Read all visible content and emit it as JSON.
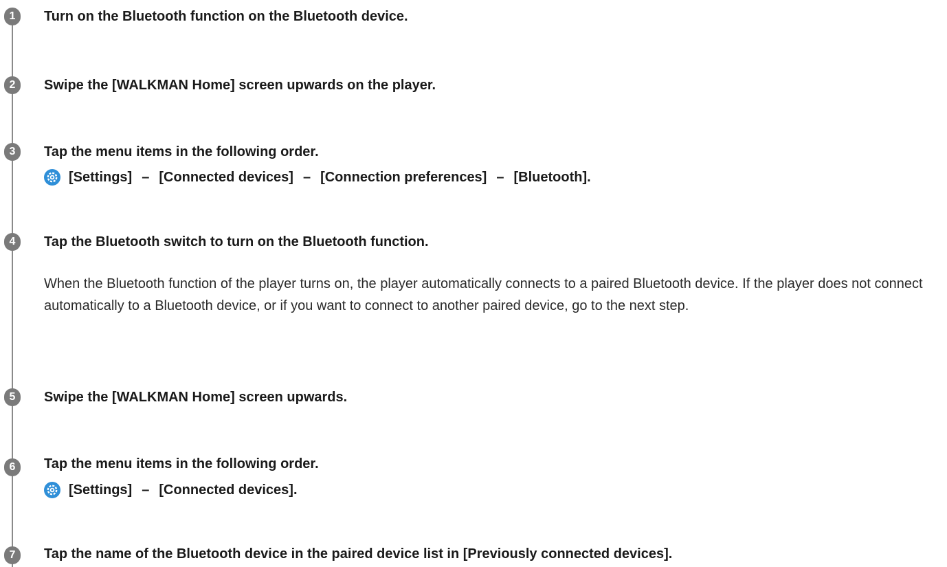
{
  "steps": [
    {
      "number": "1",
      "title": "Turn on the Bluetooth function on the Bluetooth device."
    },
    {
      "number": "2",
      "title": "Swipe the [WALKMAN Home] screen upwards on the player."
    },
    {
      "number": "3",
      "title": "Tap the menu items in the following order.",
      "path": [
        "[Settings]",
        "[Connected devices]",
        "[Connection preferences]",
        "[Bluetooth]."
      ],
      "separator": "–"
    },
    {
      "number": "4",
      "title": "Tap the Bluetooth switch to turn on the Bluetooth function.",
      "body": "When the Bluetooth function of the player turns on, the player automatically connects to a paired Bluetooth device. If the player does not connect automatically to a Bluetooth device, or if you want to connect to another paired device, go to the next step."
    },
    {
      "number": "5",
      "title": "Swipe the [WALKMAN Home] screen upwards."
    },
    {
      "number": "6",
      "title": "Tap the menu items in the following order.",
      "path": [
        "[Settings]",
        "[Connected devices]."
      ],
      "separator": "–"
    },
    {
      "number": "7",
      "title": "Tap the name of the Bluetooth device in the paired device list in [Previously connected devices]."
    }
  ],
  "icons": {
    "settings": "settings-gear-icon"
  },
  "colors": {
    "badge": "#7a7a7a",
    "timeline": "#8a8a8a",
    "settings_icon": "#2f8fd8",
    "text": "#1a1a1a"
  }
}
